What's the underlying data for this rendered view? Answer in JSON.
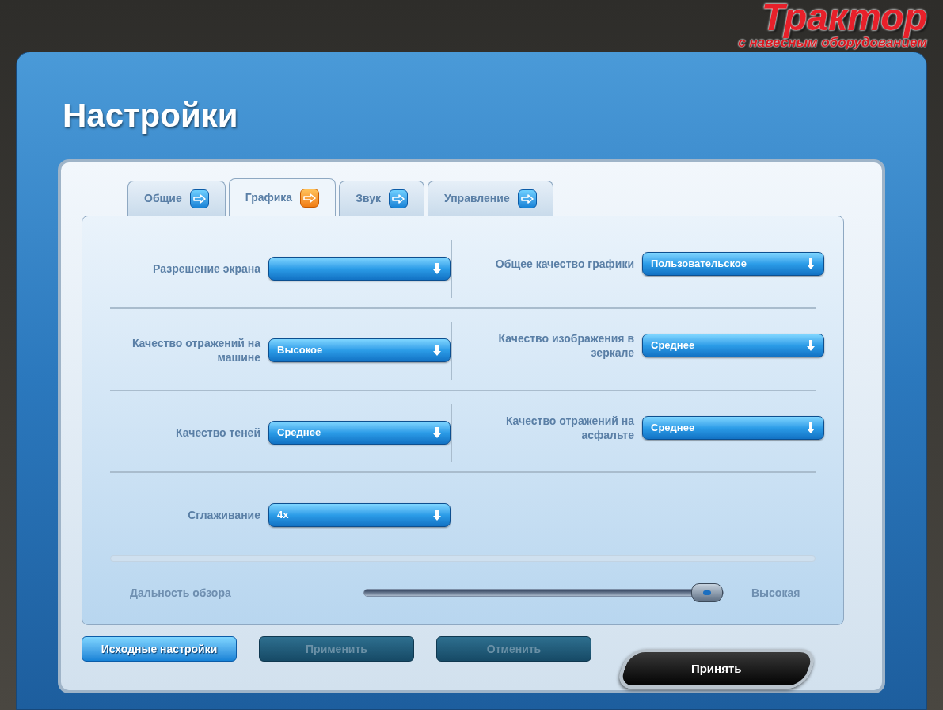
{
  "logo": {
    "title": "Трактор",
    "subtitle": "с навесным оборудованием"
  },
  "page_title": "Настройки",
  "tabs": [
    {
      "label": "Общие",
      "selected": false
    },
    {
      "label": "Графика",
      "selected": true
    },
    {
      "label": "Звук",
      "selected": false
    },
    {
      "label": "Управление",
      "selected": false
    }
  ],
  "settings": [
    {
      "label": "Разрешение экрана"
    },
    {
      "label": "Общее качество графики",
      "value": "Пользовательское"
    },
    {
      "label": "Качество отражений на машине",
      "value": "Высокое"
    },
    {
      "label": "Качество изображения в зеркале",
      "value": "Среднее"
    },
    {
      "label": "Качество теней",
      "value": "Среднее"
    },
    {
      "label": "Качество отражений на асфальте",
      "value": "Среднее"
    },
    {
      "label": "Сглаживание",
      "value": "4x"
    }
  ],
  "view_distance": {
    "label": "Дальность обзора",
    "level": 1,
    "reading": "Высокая"
  },
  "buttons": [
    {
      "label": "Исходные настройки",
      "disabled": false
    },
    {
      "label": "Применить",
      "disabled": true
    },
    {
      "label": "Отменить",
      "disabled": true
    }
  ],
  "accept_button": {
    "label": "Принять"
  }
}
